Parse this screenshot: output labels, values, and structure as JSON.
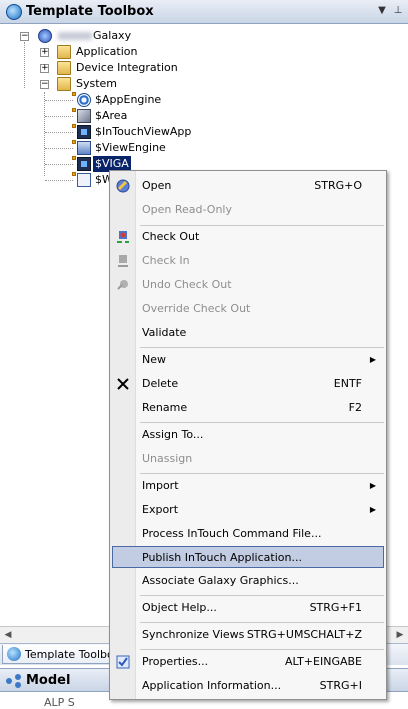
{
  "panel": {
    "title": "Template Toolbox",
    "dropdown_glyph": "▼",
    "pin_glyph": "⊥"
  },
  "tree": {
    "galaxy_label": "Galaxy",
    "application": "Application",
    "device_integration": "Device Integration",
    "system": "System",
    "appengine": "$AppEngine",
    "area": "$Area",
    "intouch_viewapp": "$InTouchViewApp",
    "viewengine": "$ViewEngine",
    "viga": "$VIGA",
    "w_partial": "$W"
  },
  "menu": {
    "open": "Open",
    "open_shortcut": "STRG+O",
    "open_readonly": "Open Read-Only",
    "check_out": "Check Out",
    "check_in": "Check In",
    "undo_check_out": "Undo Check Out",
    "override_check_out": "Override Check Out",
    "validate": "Validate",
    "new": "New",
    "delete": "Delete",
    "delete_shortcut": "ENTF",
    "rename": "Rename",
    "rename_shortcut": "F2",
    "assign_to": "Assign To...",
    "unassign": "Unassign",
    "import": "Import",
    "export": "Export",
    "process_intouch": "Process InTouch Command File...",
    "publish_intouch": "Publish InTouch Application...",
    "associate_galaxy": "Associate Galaxy Graphics...",
    "object_help": "Object Help...",
    "object_help_shortcut": "STRG+F1",
    "synchronize_views": "Synchronize Views",
    "synchronize_shortcut": "STRG+UMSCHALT+Z",
    "properties": "Properties...",
    "properties_shortcut": "ALT+EINGABE",
    "app_info": "Application Information...",
    "app_info_shortcut": "STRG+I",
    "submenu_glyph": "▶"
  },
  "bottom": {
    "tab_label": "Template Toolbo",
    "model_title": "Model",
    "model_child": "ALP S"
  },
  "colors": {
    "selection": "#0a246a",
    "highlight": "#c2cde3",
    "disabled": "#8e8e8e"
  }
}
